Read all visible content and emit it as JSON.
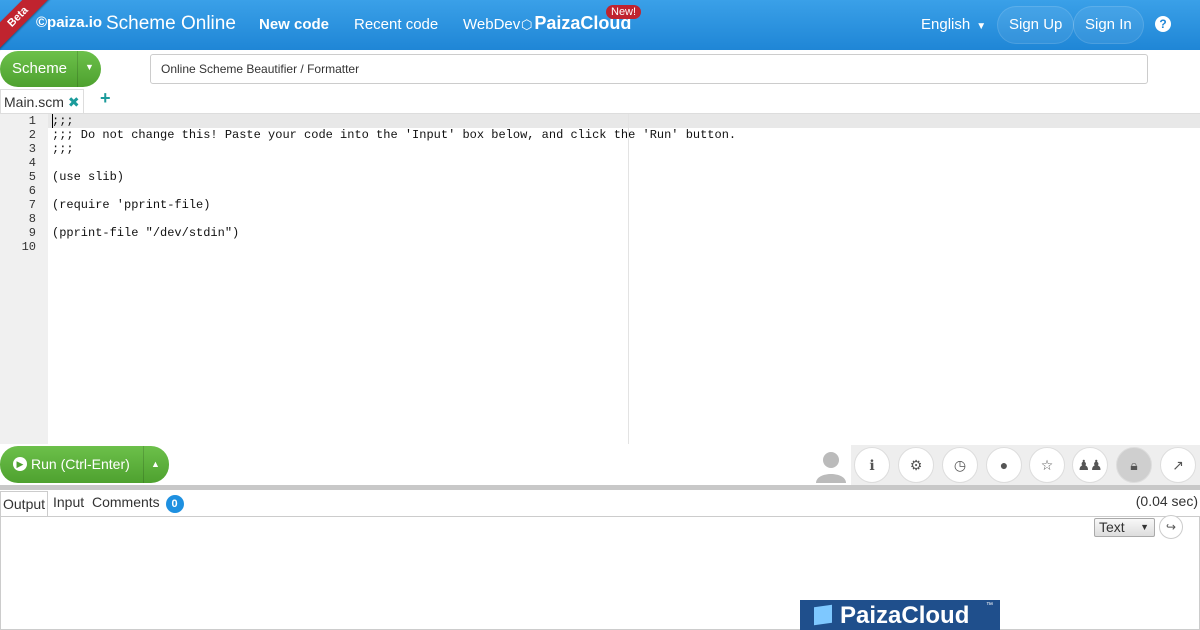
{
  "header": {
    "beta": "Beta",
    "logo": "©paiza.io",
    "app_title": "Scheme Online",
    "nav": {
      "new_code": "New code",
      "recent_code": "Recent code",
      "webdev": "WebDev"
    },
    "cloud_brand": "PaizaCloud",
    "new_badge": "New!",
    "language": "English",
    "sign_up": "Sign Up",
    "sign_in": "Sign In",
    "help": "?"
  },
  "toolbar": {
    "language_button": "Scheme",
    "title_value": "Online Scheme Beautifier / Formatter"
  },
  "tabs": {
    "file": "Main.scm",
    "add": "+"
  },
  "editor": {
    "line_numbers": [
      "1",
      "2",
      "3",
      "4",
      "5",
      "6",
      "7",
      "8",
      "9",
      "10"
    ],
    "lines": [
      ";;;",
      ";;; Do not change this! Paste your code into the 'Input' box below, and click the 'Run' button.",
      ";;;",
      "",
      "(use slib)",
      "",
      "(require 'pprint-file)",
      "",
      "(pprint-file \"/dev/stdin\")",
      ""
    ]
  },
  "run": {
    "label": "Run (Ctrl-Enter)"
  },
  "action_icons": [
    "info-icon",
    "gear-icon",
    "clock-icon",
    "github-icon",
    "star-icon",
    "users-icon",
    "lock-icon",
    "share-icon"
  ],
  "output": {
    "tabs": {
      "output": "Output",
      "input": "Input",
      "comments": "Comments"
    },
    "comment_count": "0",
    "exec_time": "(0.04 sec)",
    "format": "Text"
  },
  "ad": {
    "brand": "PaizaCloud",
    "tm": "™"
  },
  "colors": {
    "header": "#1f86d6",
    "green": "#4ea12f",
    "badge_red": "#c0242f"
  }
}
